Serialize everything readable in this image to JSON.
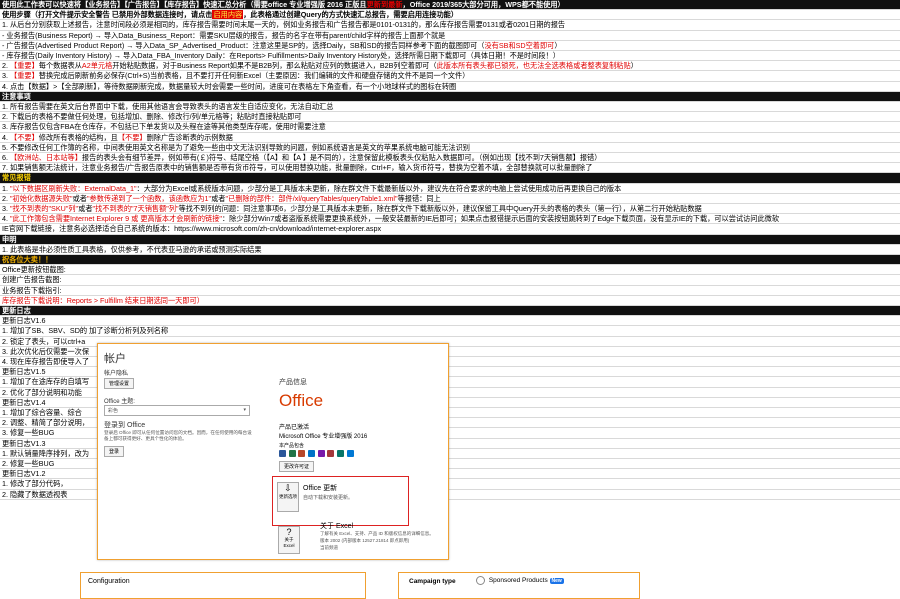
{
  "rows": [
    {
      "cls": "dark",
      "segs": [
        {
          "t": "使用此工作表可以快速将【业务报告】【广告报告】【库存报告】快速汇总分析（需要office 专业增强版 2016 正版且"
        },
        {
          "t": "更新到最新",
          "c": "red"
        },
        {
          "t": "，Office 2019/365大部分可用，WPS都不能使用）"
        }
      ]
    },
    {
      "cls": "",
      "segs": [
        {
          "t": "使用步骤（打开文件提示安全警告 已禁用外部数据连接时，请点击",
          "b": true
        },
        {
          "t": "启用内容",
          "c": "hl"
        },
        {
          "t": "，此表格通过创建Query的方式快速汇总报告，需要启用连接功能）",
          "b": true
        }
      ]
    },
    {
      "cls": "",
      "segs": [
        {
          "t": "1. 从后台分别获取上述报告，注意时间段必须是相同的，库存报告需要时间末尾一天的，例如业务报告和广告报告都是0101-0131的，那么库存报告需要0131或者0201日期的报告"
        }
      ]
    },
    {
      "cls": "",
      "segs": [
        {
          "t": "- 业务报告(Business Report) → 导入Data_Business_Report：需要SKU层级的报告，报告的名字在带有parent/child字样的报告上面那个就是"
        }
      ]
    },
    {
      "cls": "",
      "segs": [
        {
          "t": "- 广告报告(Advertised Product Report) → 导入Data_SP_Advertised_Product：注意这里是SP的，选择Daily，SB和SD的报告同样参考下面的截图即可（"
        },
        {
          "t": "没有SB和SD空着即可",
          "c": "red"
        },
        {
          "t": "）"
        }
      ]
    },
    {
      "cls": "",
      "segs": [
        {
          "t": "- 库存报告(Daily Inventory History) → 导入Data_FBA_Inventory Daily：在Reports> Fulfillments>Daily Inventory History处，选择所需日期下载即可（具体日期！不是时间段！）"
        }
      ]
    },
    {
      "cls": "",
      "segs": [
        {
          "t": "2. "
        },
        {
          "t": "【重要】",
          "c": "red"
        },
        {
          "t": "每个数据表从"
        },
        {
          "t": "A2单元格",
          "c": "red"
        },
        {
          "t": "开始粘贴数据，对于Business Report如果不是B2B列，那么粘贴对应列的数据进入，B2B列空着即可（"
        },
        {
          "t": "此版本所有表头都已锁死，也无法全选表格或者整表复制粘贴",
          "c": "red"
        },
        {
          "t": "）"
        }
      ]
    },
    {
      "cls": "",
      "segs": [
        {
          "t": "3. "
        },
        {
          "t": "【重要】",
          "c": "red"
        },
        {
          "t": "替换完成后刷新前务必保存(Ctrl+S)当前表格，且不要打开任何新Excel（主要原因：我们编辑的文件和硬盘存储的文件不是同一个文件）"
        }
      ]
    },
    {
      "cls": "",
      "segs": [
        {
          "t": "4. 点击【数据】>【全部刷新】，等待数据刷新完成，数据量较大时会需要一些时间，进度可在表格左下角查看，有一个小地球样式的图标在转圈"
        }
      ]
    },
    {
      "cls": "sec",
      "segs": [
        {
          "t": "注意事项"
        }
      ]
    },
    {
      "cls": "",
      "segs": [
        {
          "t": "1. 所有报告需要在英文后台界面中下载，使用其他语言会导致表头的语言发生自适应变化，无法自动汇总"
        }
      ]
    },
    {
      "cls": "",
      "segs": [
        {
          "t": "2. 下载后的表格不要做任何处理，包括增加、删除、修改行/列/单元格等；粘贴时直接粘贴即可"
        }
      ]
    },
    {
      "cls": "",
      "segs": [
        {
          "t": "3. 库存报告仅包含FBA在仓库存，不包括已下单发货以及头程在途等其他类型库存呢，使用时需要注意"
        }
      ]
    },
    {
      "cls": "",
      "segs": [
        {
          "t": "4. "
        },
        {
          "t": "【不要】",
          "c": "red"
        },
        {
          "t": "修改所有表格的结构，且"
        },
        {
          "t": "【不要】",
          "c": "red"
        },
        {
          "t": "删除广告诊断表的示例数据"
        }
      ]
    },
    {
      "cls": "",
      "segs": [
        {
          "t": "5. 不要修改任何工作簿的名称，中间表使用英文名称是为了避免一些由中文无法识别导致的问题，例如系统语言是英文的苹果系统电脑可能无法识别"
        }
      ]
    },
    {
      "cls": "",
      "segs": [
        {
          "t": "6. "
        },
        {
          "t": "【欧洲站、日本站等】",
          "c": "red"
        },
        {
          "t": "报告的表头会有细节差异，例如带有(￡)符号、结尾空格（【A】和【A 】是不同的），注意保留此模板表头仅粘贴入数据即可。（例如出现【找不到7天销售额】报错）"
        }
      ]
    },
    {
      "cls": "",
      "segs": [
        {
          "t": "7. 如果销售额无法统计，注意业务报告/广告报告原表中的销售额是否带有货币符号，可以使用替换功能，批量删除，Ctrl+F，输入货币符号，替换为空着不填，全部替换就可以批量删除了"
        }
      ]
    },
    {
      "cls": "sec yellowbar",
      "segs": [
        {
          "t": "常见报错"
        }
      ]
    },
    {
      "cls": "",
      "segs": [
        {
          "t": "1. "
        },
        {
          "t": "\"以下数据区刷新失败：ExternalData_1\"",
          "c": "red"
        },
        {
          "t": "：大部分为Excel或系统版本问题，少部分是工具版本未更新，除在群文件下载最新版以外，建议先在符合要求的电脑上尝试使用成功后再更换自己的版本"
        }
      ]
    },
    {
      "cls": "",
      "segs": [
        {
          "t": "2. "
        },
        {
          "t": "\"初始化数据源失败\"",
          "c": "red"
        },
        {
          "t": "或者"
        },
        {
          "t": "\"参数传递到了一个函数，该函数应为1\"",
          "c": "red"
        },
        {
          "t": "或者"
        },
        {
          "t": "\"已删除的部件：部件/xl/queryTables/queryTable1.xml\"",
          "c": "red"
        },
        {
          "t": "等报错：同上"
        }
      ]
    },
    {
      "cls": "",
      "segs": [
        {
          "t": "3. "
        },
        {
          "t": "\"找不到表的\"SKU\"列\"",
          "c": "red"
        },
        {
          "t": "或者"
        },
        {
          "t": "\"找不到表的\"7天销售额\"列\"",
          "c": "red"
        },
        {
          "t": "等找不到列的问题：同注意事项6，少部分是工具版本未更新，除在群文件下载新版以外，建议保留工具中Query开头的表格的表头（第一行），从第二行开始粘贴数据"
        }
      ]
    },
    {
      "cls": "",
      "segs": [
        {
          "t": "4. "
        },
        {
          "t": "\"此工作簿包含需要Internet Explorer 9 或 更高版本才会刷新的链接\"",
          "c": "red"
        },
        {
          "t": "：除少部分Win7或者盗版系统需要更换系统外，一般安装最新的IE后即可；如果点击报错提示后面的安装按钮跳转到了Edge下载页面，没有显示IE的下载，可以尝试访问此微软"
        }
      ]
    },
    {
      "cls": "",
      "segs": [
        {
          "t": "IE官网下载链接，注意务必选择适合自己系统的版本：https://www.microsoft.com/zh-cn/download/internet-explorer.aspx"
        }
      ]
    },
    {
      "cls": "sec",
      "segs": [
        {
          "t": "申明"
        }
      ]
    },
    {
      "cls": "",
      "segs": [
        {
          "t": "1. 此表格是非必须性质工具表格，仅供参考，不代表亚马逊的承诺或预测实际结果"
        }
      ]
    },
    {
      "cls": "sec",
      "segs": [
        {
          "t": "祝各位大卖！！",
          "c": "amber"
        }
      ]
    },
    {
      "cls": "",
      "segs": [
        {
          "t": "Office更新按钮截图:"
        }
      ]
    },
    {
      "cls": "",
      "segs": [
        {
          "t": "创建广告报告截图:"
        }
      ]
    },
    {
      "cls": "",
      "segs": [
        {
          "t": "业务报告下载指引:"
        }
      ]
    },
    {
      "cls": "",
      "segs": [
        {
          "t": "库存报告下载说明：Reports > Fulfillm",
          "c": "red"
        },
        {
          "t": "                                                                                                                                                     ",
          "c": ""
        },
        {
          "t": "结束日期选同一天即可）",
          "c": "red"
        }
      ]
    },
    {
      "cls": "sec",
      "segs": [
        {
          "t": "更新日志"
        }
      ]
    },
    {
      "cls": "",
      "segs": [
        {
          "t": "更新日志V1.6"
        }
      ]
    },
    {
      "cls": "",
      "segs": [
        {
          "t": "1. 增加了SB、SBV、SD的",
          "b": false
        },
        {
          "t": "                                                                                                                                                     "
        },
        {
          "t": "加了诊断分析列及列名称"
        }
      ]
    },
    {
      "cls": "",
      "segs": [
        {
          "t": "2. 锁定了表头，可以ctrl+a"
        }
      ]
    },
    {
      "cls": "",
      "segs": [
        {
          "t": "3. 此次优化后仅需要一次保"
        }
      ]
    },
    {
      "cls": "",
      "segs": [
        {
          "t": "4. 现在库存报告即使导入了"
        }
      ]
    },
    {
      "cls": "",
      "segs": [
        {
          "t": "更新日志V1.5"
        }
      ]
    },
    {
      "cls": "",
      "segs": [
        {
          "t": "1. 增加了在途库存的自填写"
        }
      ]
    },
    {
      "cls": "",
      "segs": [
        {
          "t": "2. 优化了部分说明和功能"
        }
      ]
    },
    {
      "cls": "",
      "segs": [
        {
          "t": "更新日志V1.4"
        }
      ]
    },
    {
      "cls": "",
      "segs": [
        {
          "t": "1. 增加了综合容量、综合"
        }
      ]
    },
    {
      "cls": "",
      "segs": [
        {
          "t": "2. 调整、精简了部分说明，"
        }
      ]
    },
    {
      "cls": "",
      "segs": [
        {
          "t": "3. 修复一些BUG"
        }
      ]
    },
    {
      "cls": "",
      "segs": [
        {
          "t": "更新日志V1.3"
        }
      ]
    },
    {
      "cls": "",
      "segs": [
        {
          "t": "1. 默认销量降序排列，改为"
        }
      ]
    },
    {
      "cls": "",
      "segs": [
        {
          "t": "2. 修复一些BUG"
        }
      ]
    },
    {
      "cls": "",
      "segs": [
        {
          "t": "更新日志V1.2"
        }
      ]
    },
    {
      "cls": "",
      "segs": [
        {
          "t": "1. 修改了部分代码，"
        }
      ]
    },
    {
      "cls": "",
      "segs": [
        {
          "t": "2. 隐藏了数据透视表"
        }
      ]
    }
  ],
  "dialog": {
    "title": "帐户",
    "privacy": "帐户隐私",
    "manage_btn": "管理设置",
    "theme_label": "Office 主题:",
    "theme_value": "彩色",
    "signin_title": "登录到 Office",
    "signin_desc": "登录后 Office 即可从任何位置访问您的文档。因而，在任何使用的每台设备上都可获得更好、更具个性化的体验。",
    "signin_btn": "登录",
    "product_info": "产品信息",
    "office_brand": "Office",
    "activated": "产品已激活",
    "product_name": "Microsoft Office 专业增强版 2016",
    "contains": "本产品包含",
    "change_key": "更改许可证",
    "update_title": "Office 更新",
    "update_desc": "自动下载和安装更新。",
    "update_options": "更新选项",
    "about_title": "关于 Excel",
    "about_desc": "了解有关 Excel、支持、产品 ID 和版权信息的详细信息。",
    "about_version": "版本 2002 (内部版本 12527.21814 即点即用)",
    "about_channel": "当前频道",
    "about_btn": "关于 Excel"
  },
  "config_title": "Configuration",
  "campaign": {
    "label": "Campaign type",
    "option": "Sponsored Products",
    "badge": "New"
  }
}
